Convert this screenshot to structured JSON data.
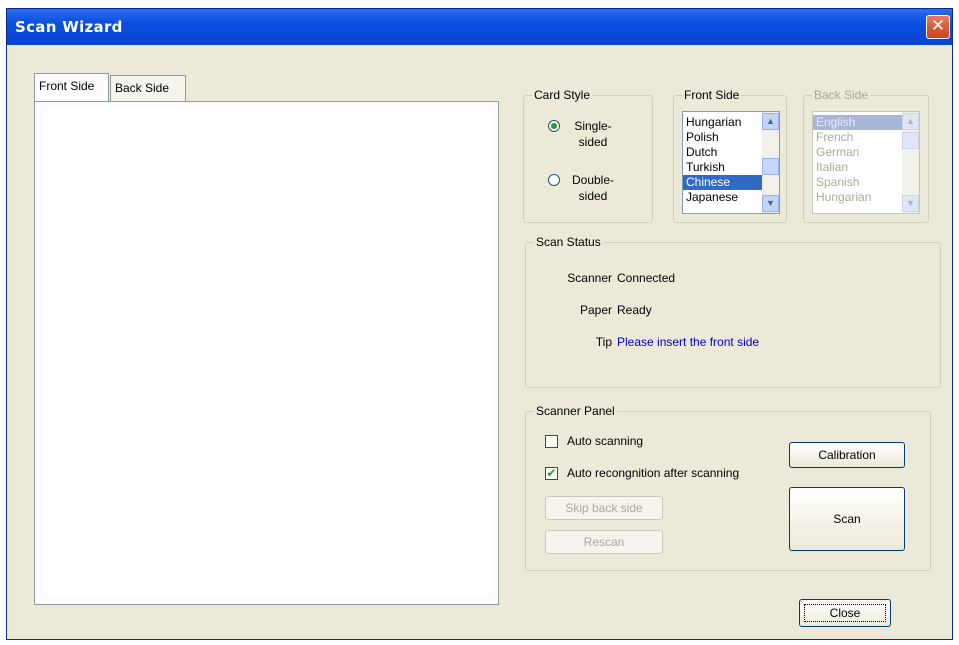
{
  "window": {
    "title": "Scan Wizard",
    "close_symbol": "✕"
  },
  "tabs": [
    {
      "label": "Front Side"
    },
    {
      "label": "Back Side"
    }
  ],
  "card_style": {
    "legend": "Card Style",
    "options": [
      {
        "label": "Single-sided",
        "checked": true
      },
      {
        "label": "Double-sided",
        "checked": false
      }
    ]
  },
  "front_side": {
    "legend": "Front Side",
    "items": [
      "Hungarian",
      "Polish",
      "Dutch",
      "Turkish",
      "Chinese",
      "Japanese"
    ],
    "selected": "Chinese"
  },
  "back_side": {
    "legend": "Back Side",
    "disabled": true,
    "items": [
      "English",
      "French",
      "German",
      "Italian",
      "Spanish",
      "Hungarian"
    ],
    "selected": "English"
  },
  "scan_status": {
    "legend": "Scan Status",
    "scanner_label": "Scanner",
    "scanner_value": "Connected",
    "paper_label": "Paper",
    "paper_value": "Ready",
    "tip_label": "Tip",
    "tip_value": "Please insert the front side"
  },
  "scanner_panel": {
    "legend": "Scanner Panel",
    "auto_scanning": {
      "label": "Auto scanning",
      "checked": false
    },
    "auto_recognition": {
      "label": "Auto recongnition after scanning",
      "checked": true
    },
    "skip_back_side": "Skip back side",
    "rescan": "Rescan",
    "calibration": "Calibration",
    "scan": "Scan"
  },
  "close_label": "Close",
  "colors": {
    "title_bar": "#0a4ee0",
    "dialog_bg": "#ece9d8",
    "selection": "#316ac5",
    "tip_text": "#0000c8"
  }
}
